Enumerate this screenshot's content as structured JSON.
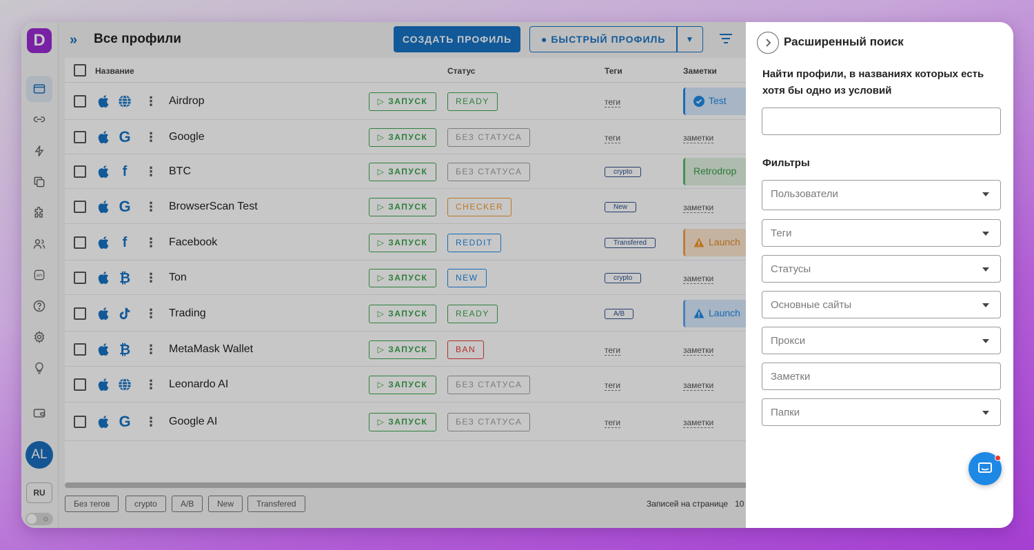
{
  "header": {
    "title": "Все профили",
    "create_label": "СОЗДАТЬ ПРОФИЛЬ",
    "quick_label": "БЫСТРЫЙ ПРОФИЛЬ"
  },
  "sidebar": {
    "logo": "D",
    "items": [
      "profiles-icon",
      "link-icon",
      "automation-icon",
      "copy-icon",
      "extensions-icon",
      "users-icon",
      "api-icon",
      "help-icon",
      "settings-icon",
      "idea-icon",
      "wallet-icon"
    ],
    "avatar": "AL",
    "lang": "RU"
  },
  "table": {
    "columns": {
      "name": "Название",
      "status": "Статус",
      "tags": "Теги",
      "notes": "Заметки"
    },
    "rows": [
      {
        "name": "Airdrop",
        "site": "globe",
        "launch": "ЗАПУСК",
        "status": "READY",
        "tags": "теги",
        "tag_chip": false,
        "notes": "Test",
        "note_type": "blue-check"
      },
      {
        "name": "Google",
        "site": "google",
        "launch": "ЗАПУСК",
        "status": "БЕЗ СТАТУСА",
        "tags": "теги",
        "tag_chip": false,
        "notes": "заметки",
        "note_type": "link"
      },
      {
        "name": "BTC",
        "site": "facebook",
        "launch": "ЗАПУСК",
        "status": "БЕЗ СТАТУСА",
        "tags": "crypto",
        "tag_chip": true,
        "notes": "Retrodrop",
        "note_type": "green"
      },
      {
        "name": "BrowserScan Test",
        "site": "google",
        "launch": "ЗАПУСК",
        "status": "CHECKER",
        "tags": "New",
        "tag_chip": true,
        "notes": "заметки",
        "note_type": "link"
      },
      {
        "name": "Facebook",
        "site": "facebook",
        "launch": "ЗАПУСК",
        "status": "REDDIT",
        "tags": "Transfered",
        "tag_chip": true,
        "notes": "Launch",
        "note_type": "orange-warn"
      },
      {
        "name": "Ton",
        "site": "bitcoin",
        "launch": "ЗАПУСК",
        "status": "NEW",
        "tags": "crypto",
        "tag_chip": true,
        "notes": "заметки",
        "note_type": "link"
      },
      {
        "name": "Trading",
        "site": "tiktok",
        "launch": "ЗАПУСК",
        "status": "READY",
        "tags": "A/B",
        "tag_chip": true,
        "notes": "Launch",
        "note_type": "blue-warn"
      },
      {
        "name": "MetaMask Wallet",
        "site": "bitcoin",
        "launch": "ЗАПУСК",
        "status": "BAN",
        "tags": "теги",
        "tag_chip": false,
        "notes": "заметки",
        "note_type": "link"
      },
      {
        "name": "Leonardo AI",
        "site": "globe",
        "launch": "ЗАПУСК",
        "status": "БЕЗ СТАТУСА",
        "tags": "теги",
        "tag_chip": false,
        "notes": "заметки",
        "note_type": "link"
      },
      {
        "name": "Google AI",
        "site": "google",
        "launch": "ЗАПУСК",
        "status": "БЕЗ СТАТУСА",
        "tags": "теги",
        "tag_chip": false,
        "notes": "заметки",
        "note_type": "link"
      }
    ]
  },
  "status_colors": {
    "READY": "#3aa34d",
    "БЕЗ СТАТУСА": "#9e9e9e",
    "CHECKER": "#f0962a",
    "REDDIT": "#1e88e5",
    "NEW": "#1e88e5",
    "BAN": "#e53935"
  },
  "footer": {
    "tag_filters": [
      "Без тегов",
      "crypto",
      "A/B",
      "New",
      "Transfered"
    ],
    "per_page_label": "Записей на странице",
    "per_page_value": "10"
  },
  "panel": {
    "title": "Расширенный поиск",
    "description": "Найти профили, в названиях которых есть хотя бы одно из условий",
    "search_value": "",
    "filters_title": "Фильтры",
    "filters": [
      {
        "label": "Пользователи",
        "dropdown": true
      },
      {
        "label": "Теги",
        "dropdown": true
      },
      {
        "label": "Статусы",
        "dropdown": true
      },
      {
        "label": "Основные сайты",
        "dropdown": true
      },
      {
        "label": "Прокси",
        "dropdown": true
      },
      {
        "label": "Заметки",
        "dropdown": false
      },
      {
        "label": "Папки",
        "dropdown": true
      }
    ]
  },
  "colors": {
    "accent": "#1672c4",
    "brand": "#9a2bd3",
    "launch": "#3aa34d"
  }
}
